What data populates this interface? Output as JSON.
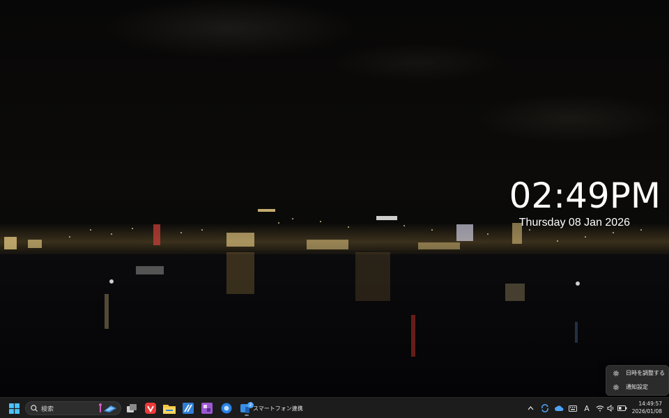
{
  "desktop_clock": {
    "time": "02:49PM",
    "date": "Thursday 08 Jan 2026"
  },
  "context_menu": {
    "items": [
      {
        "label": "日時を調整する",
        "icon": "gear-icon"
      },
      {
        "label": "通知設定",
        "icon": "gear-icon"
      }
    ]
  },
  "taskbar": {
    "search_placeholder": "検索",
    "pinned_apps": [
      {
        "name": "task-view",
        "icon": "task-view-icon"
      },
      {
        "name": "vivaldi",
        "icon": "vivaldi-icon",
        "color": "#ef3939"
      },
      {
        "name": "file-explorer",
        "icon": "folder-icon",
        "color": "#f5c542"
      },
      {
        "name": "app-blue",
        "icon": "app-blue-icon",
        "color": "#2f7fd8"
      },
      {
        "name": "app-purple",
        "icon": "app-purple-icon",
        "color": "#9b59d0"
      },
      {
        "name": "app-circle",
        "icon": "app-circle-icon",
        "color": "#2a82e4"
      }
    ],
    "phone_link": {
      "label": "スマートフォン連携",
      "badge": "2"
    },
    "tray_ime": "A",
    "clock_time": "14:49:57",
    "clock_date": "2026/01/08"
  },
  "colors": {
    "taskbar_bg": "#1c1c1c",
    "accent": "#4ea3f5"
  }
}
